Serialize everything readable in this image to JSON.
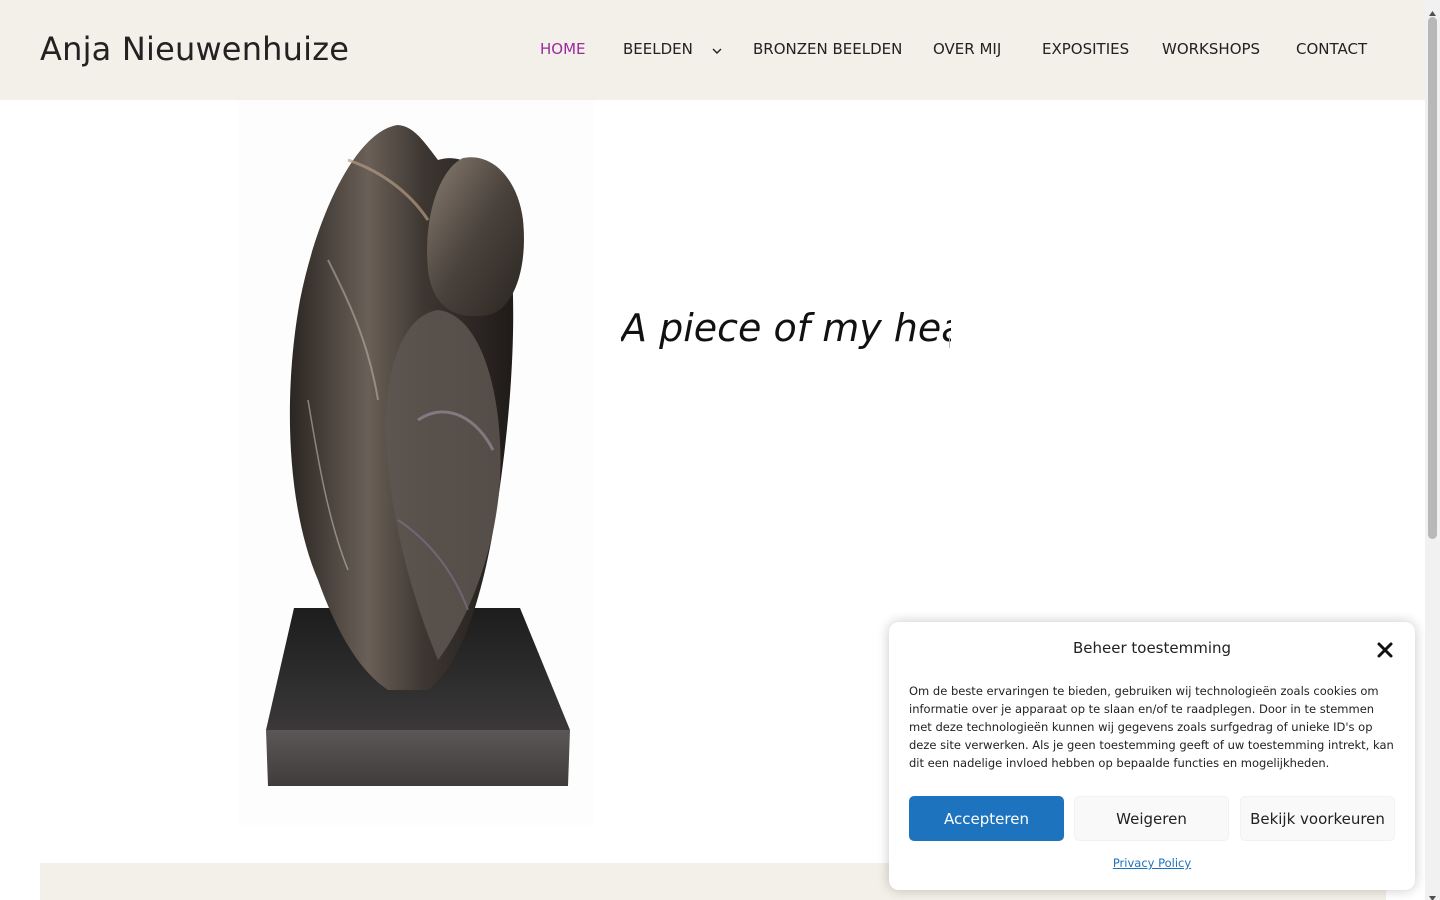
{
  "site": {
    "title": "Anja Nieuwenhuize"
  },
  "nav": {
    "items": [
      {
        "label": "HOME",
        "active": true
      },
      {
        "label": "BEELDEN",
        "has_dropdown": true
      },
      {
        "label": "BRONZEN BEELDEN"
      },
      {
        "label": "OVER MIJ"
      },
      {
        "label": "EXPOSITIES"
      },
      {
        "label": "WORKSHOPS"
      },
      {
        "label": "CONTACT"
      }
    ]
  },
  "hero": {
    "text": "A piece of my heart",
    "image_icon": "sculpture-image"
  },
  "cookie": {
    "title": "Beheer toestemming",
    "body": "Om de beste ervaringen te bieden, gebruiken wij technologieën zoals cookies om informatie over je apparaat op te slaan en/of te raadplegen. Door in te stemmen met deze technologieën kunnen wij gegevens zoals surfgedrag of unieke ID's op deze site verwerken. Als je geen toestemming geeft of uw toestemming intrekt, kan dit een nadelige invloed hebben op bepaalde functies en mogelijkheden.",
    "accept_label": "Accepteren",
    "deny_label": "Weigeren",
    "prefs_label": "Bekijk voorkeuren",
    "privacy_label": "Privacy Policy",
    "close_icon": "close-icon"
  },
  "colors": {
    "header_bg": "#f3efe9",
    "nav_active": "#9b2a9c",
    "accent_blue": "#1e73be"
  }
}
